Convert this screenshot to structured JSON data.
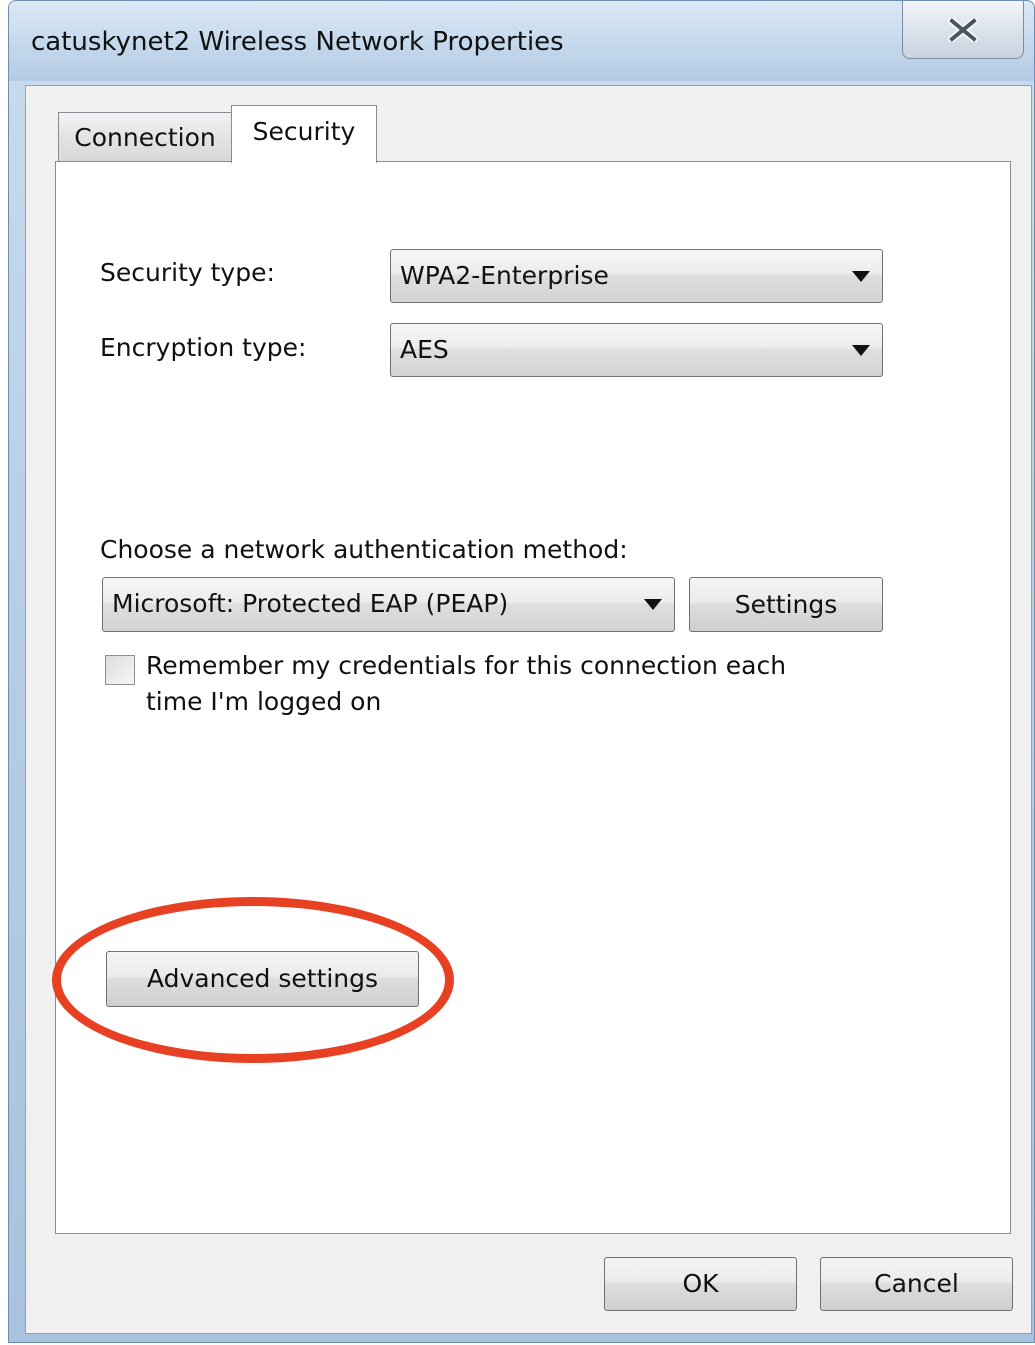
{
  "window": {
    "title": "catuskynet2 Wireless Network Properties"
  },
  "tabs": [
    {
      "label": "Connection",
      "selected": false
    },
    {
      "label": "Security",
      "selected": true
    }
  ],
  "security": {
    "security_type_label": "Security type:",
    "security_type_value": "WPA2-Enterprise",
    "encryption_type_label": "Encryption type:",
    "encryption_type_value": "AES",
    "auth_method_label": "Choose a network authentication method:",
    "auth_method_value": "Microsoft: Protected EAP (PEAP)",
    "settings_button": "Settings",
    "remember_line1": "Remember my credentials for this connection each",
    "remember_line2": "time I'm logged on",
    "remember_checked": false,
    "advanced_button": "Advanced settings"
  },
  "footer": {
    "ok_label": "OK",
    "cancel_label": "Cancel"
  },
  "colors": {
    "highlight": "#e84022"
  },
  "icons": {
    "close": "close-icon",
    "dropdown": "chevron-down-icon"
  }
}
